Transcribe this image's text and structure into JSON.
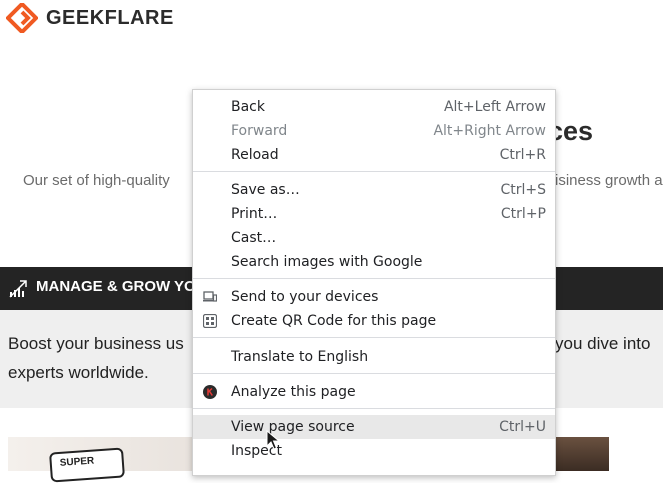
{
  "page": {
    "logo_text": "GEEKFLARE",
    "hero_title_tail": "ces",
    "hero_sub_left": "Our set of high-quality",
    "hero_sub_right": "isiness growth a",
    "band_text": "MANAGE & GROW YO",
    "grey_line1_left": "Boost your business us",
    "grey_line1_right": "you dive into",
    "grey_line2": "experts worldwide.",
    "badge_text": "SUPER"
  },
  "colors": {
    "brand_orange": "#f05a22",
    "dark_band": "#242424",
    "menu_hover": "#e8e8e8"
  },
  "menu": {
    "back": {
      "label": "Back",
      "shortcut": "Alt+Left Arrow"
    },
    "forward": {
      "label": "Forward",
      "shortcut": "Alt+Right Arrow"
    },
    "reload": {
      "label": "Reload",
      "shortcut": "Ctrl+R"
    },
    "save_as": {
      "label": "Save as…",
      "shortcut": "Ctrl+S"
    },
    "print": {
      "label": "Print…",
      "shortcut": "Ctrl+P"
    },
    "cast": {
      "label": "Cast…"
    },
    "search_images": {
      "label": "Search images with Google"
    },
    "send_devices": {
      "label": "Send to your devices",
      "icon": "devices-icon"
    },
    "qr_code": {
      "label": "Create QR Code for this page",
      "icon": "qr-code-icon"
    },
    "translate": {
      "label": "Translate to English"
    },
    "analyze": {
      "label": "Analyze this page",
      "icon": "extension-k-icon"
    },
    "view_source": {
      "label": "View page source",
      "shortcut": "Ctrl+U"
    },
    "inspect": {
      "label": "Inspect"
    }
  }
}
